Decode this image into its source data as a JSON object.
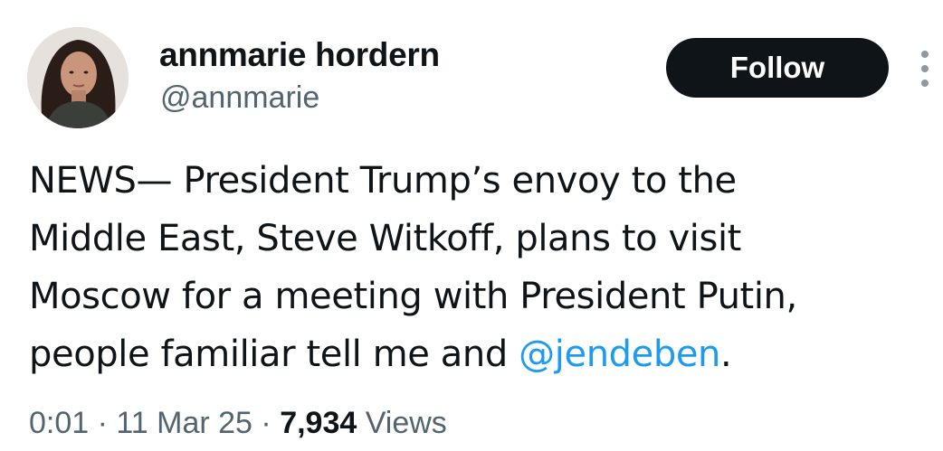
{
  "author": {
    "display_name": "annmarie hordern",
    "handle": "@annmarie"
  },
  "follow_button": {
    "label": "Follow"
  },
  "more_menu": {
    "icon": "more-vertical-icon"
  },
  "tweet": {
    "lines": [
      "NEWS— President Trump’s envoy to the",
      "Middle East, Steve Witkoff, plans to visit",
      "Moscow for a meeting with President Putin,",
      "people familiar tell me and "
    ],
    "mention": "@jendeben",
    "trailing": "."
  },
  "meta": {
    "time": "0:01",
    "sep1": " · ",
    "date": "11 Mar 25",
    "sep2": " · ",
    "views_count": "7,934",
    "views_label": " Views"
  },
  "colors": {
    "text": "#0f1419",
    "secondary": "#536471",
    "link": "#1d9bf0",
    "button_bg": "#0f1419",
    "button_text": "#ffffff"
  }
}
